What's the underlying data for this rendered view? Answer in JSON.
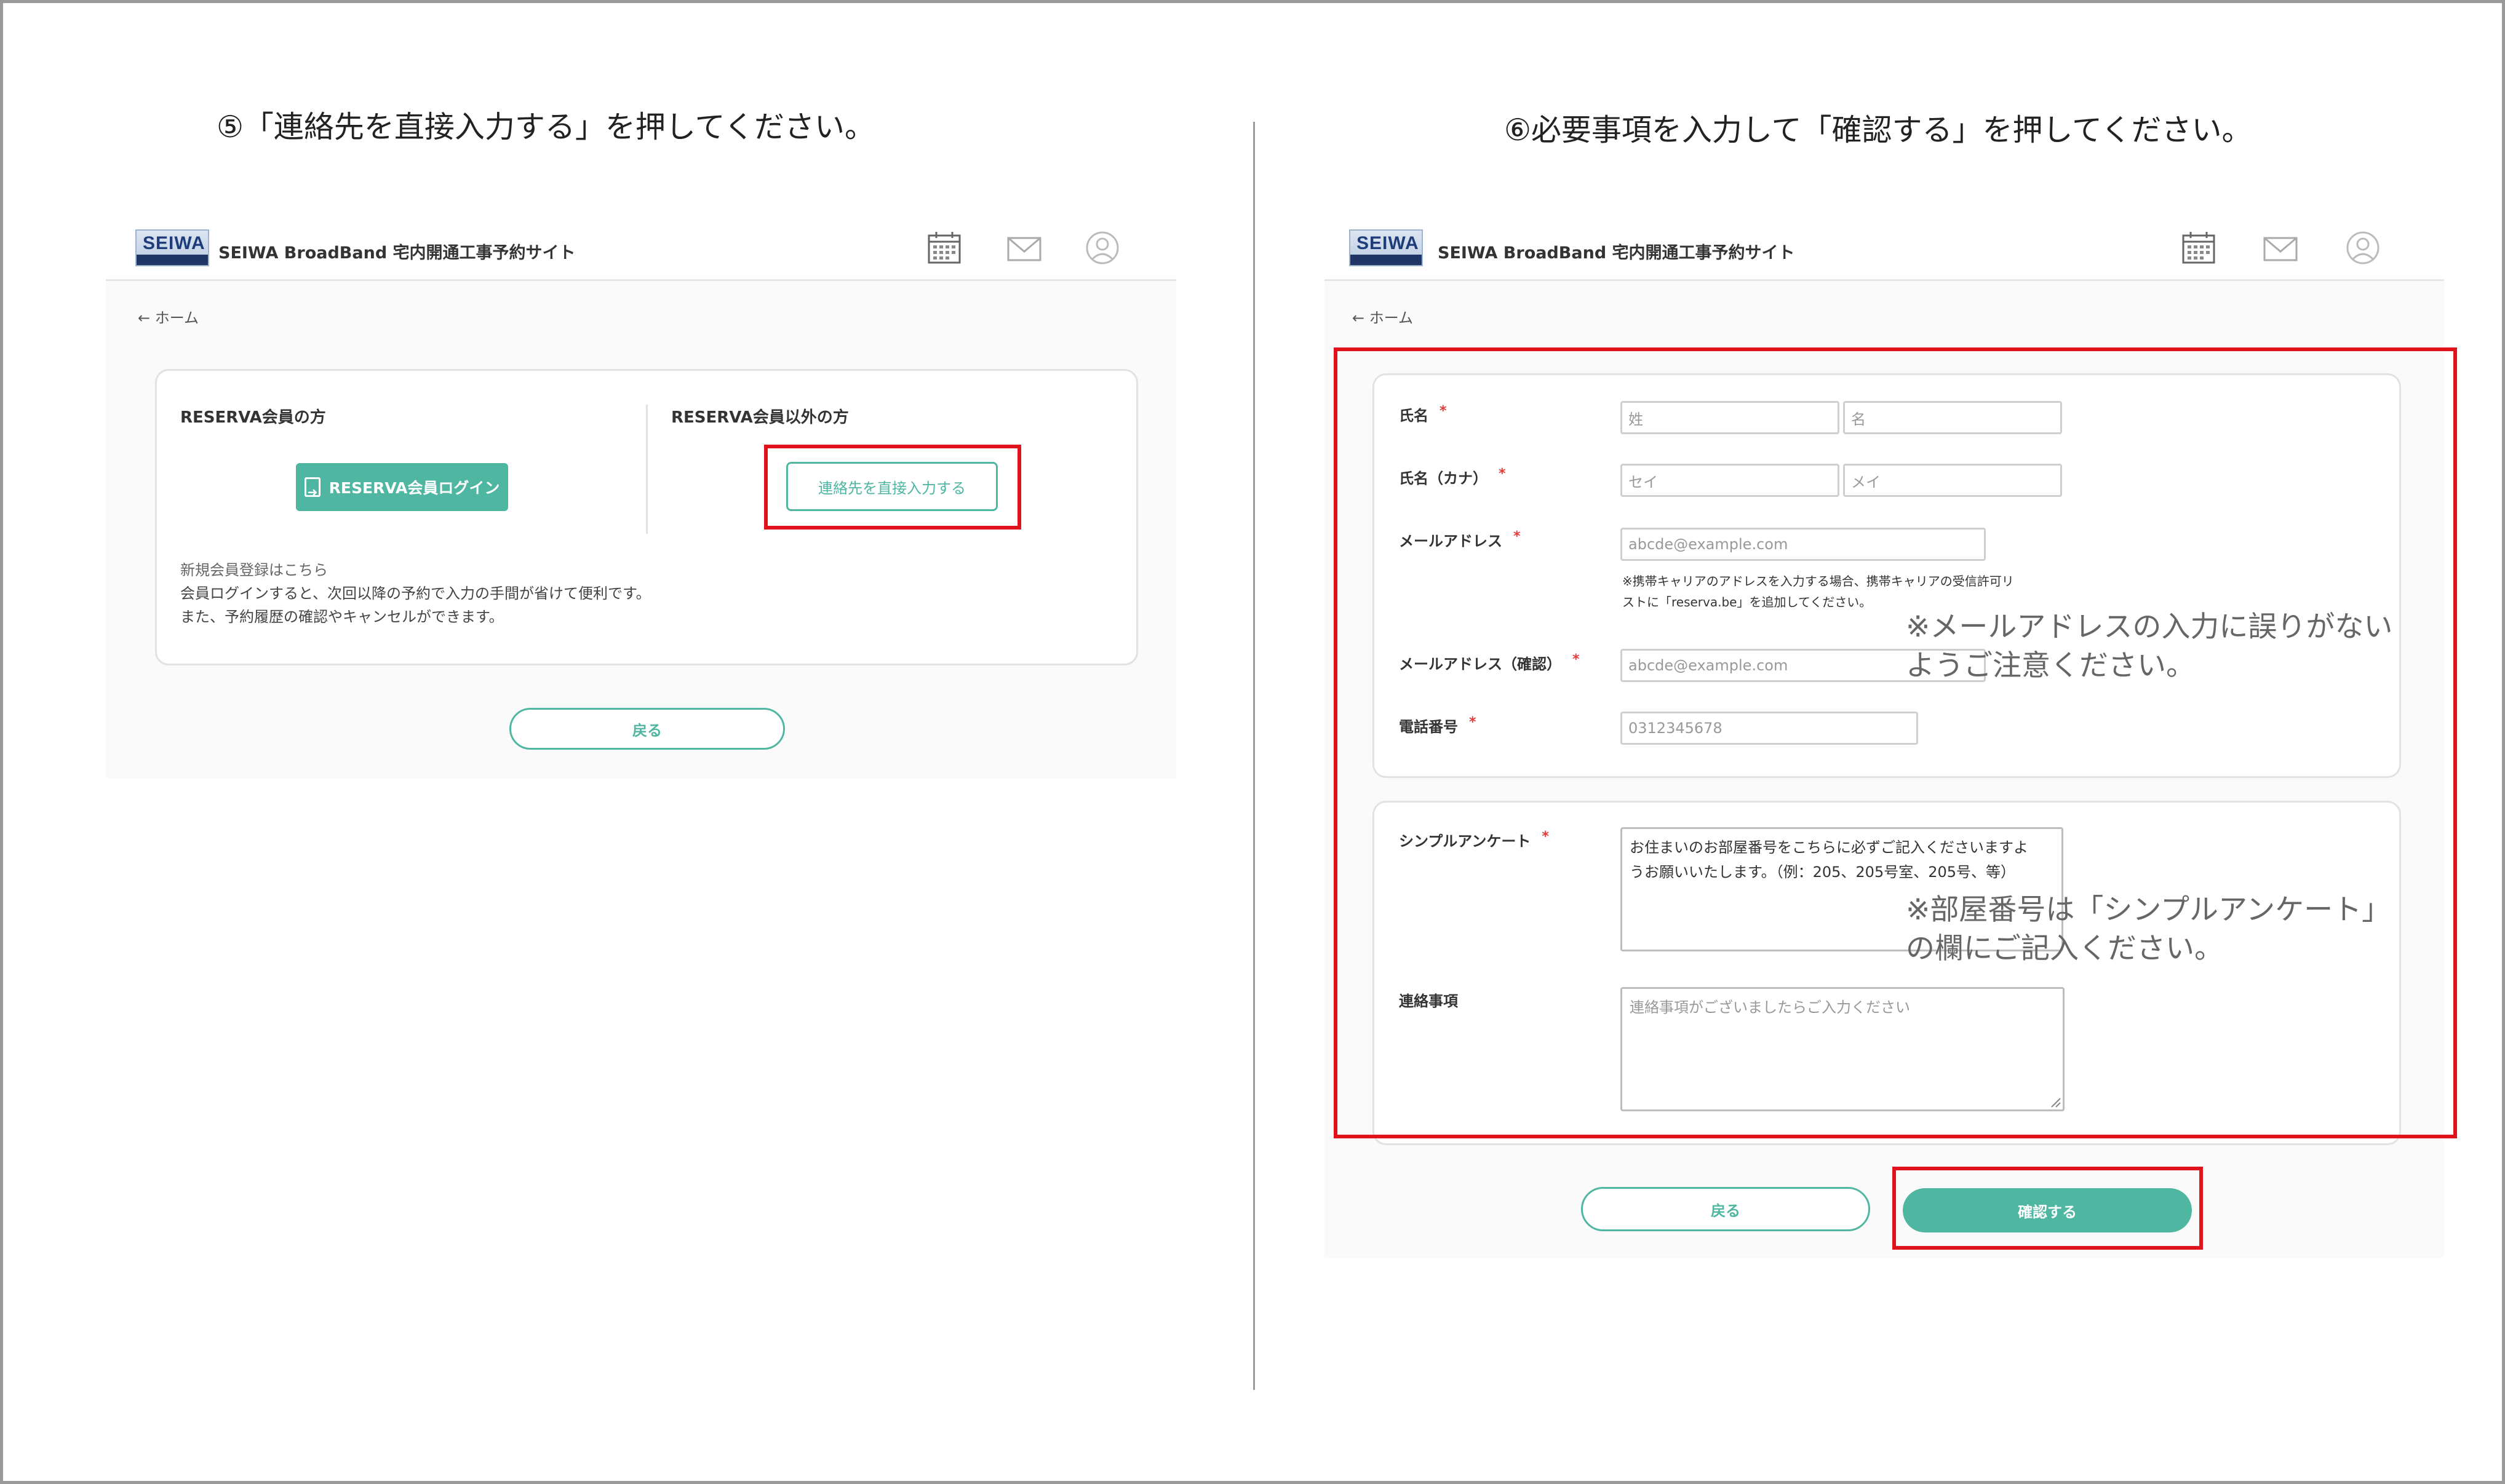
{
  "instructions": {
    "step5": "⑤「連絡先を直接入力する」を押してください。",
    "step6": "⑥必要事項を入力して「確認する」を押してください。"
  },
  "site": {
    "logo_text": "SEIWA",
    "title": "SEIWA BroadBand 宅内開通工事予約サイト",
    "icons": [
      "calendar-icon",
      "mail-icon",
      "user-icon"
    ]
  },
  "screen5": {
    "breadcrumb": "← ホーム",
    "member_label": "RESERVA会員の方",
    "nonmember_label": "RESERVA会員以外の方",
    "login_button": "RESERVA会員ログイン",
    "direct_input_button": "連絡先を直接入力する",
    "register_link": "新規会員登録はこちら",
    "note_line1": "会員ログインすると、次回以降の予約で入力の手間が省けて便利です。",
    "note_line2": "また、予約履歴の確認やキャンセルができます。",
    "back_button": "戻る"
  },
  "screen6": {
    "breadcrumb": "← ホーム",
    "required_mark": "*",
    "fields": {
      "name_label": "氏名",
      "last_name_placeholder": "姓",
      "first_name_placeholder": "名",
      "kana_label": "氏名（カナ）",
      "last_kana_placeholder": "セイ",
      "first_kana_placeholder": "メイ",
      "email_label": "メールアドレス",
      "email_placeholder": "abcde@example.com",
      "email_note_line1": "※携帯キャリアのアドレスを入力する場合、携帯キャリアの受信許可リ",
      "email_note_line2": "ストに「reserva.be」を追加してください。",
      "email_confirm_label": "メールアドレス（確認）",
      "email_confirm_placeholder": "abcde@example.com",
      "phone_label": "電話番号",
      "phone_placeholder": "0312345678",
      "survey_label": "シンプルアンケート",
      "survey_value_line1": "お住まいのお部屋番号をこちらに必ずご記入くださいますよ",
      "survey_value_line2": "うお願いいたします。（例：205、205号室、205号、等）",
      "contact_label": "連絡事項",
      "contact_placeholder": "連絡事項がございましたらご入力ください"
    },
    "callout_email_line1": "※メールアドレスの入力に誤りがない",
    "callout_email_line2": "ようご注意ください。",
    "callout_room_line1": "※部屋番号は「シンプルアンケート」",
    "callout_room_line2": "の欄にご記入ください。",
    "back_button": "戻る",
    "confirm_button": "確認する"
  },
  "colors": {
    "accent": "#4fb6a1",
    "highlight": "#e0121b",
    "required": "#e53935"
  }
}
